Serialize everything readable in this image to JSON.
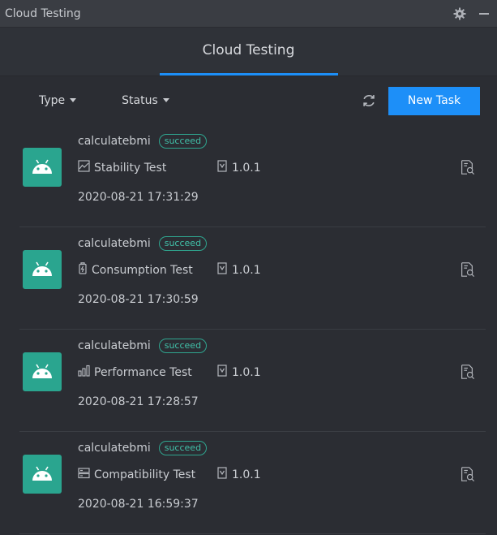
{
  "window": {
    "title": "Cloud Testing"
  },
  "header": {
    "settings_icon": "gear-icon",
    "minimize_icon": "minimize-icon"
  },
  "tabs": [
    {
      "label": "Cloud Testing",
      "active": true
    }
  ],
  "toolbar": {
    "type_label": "Type",
    "status_label": "Status",
    "refresh_icon": "refresh-icon",
    "new_task_label": "New Task"
  },
  "colors": {
    "accent": "#1d8ff8",
    "avatar": "#2aa58f",
    "badge": "#41c1a9",
    "background": "#2b2d33"
  },
  "tasks": [
    {
      "app": "calculatebmi",
      "status": "succeed",
      "type": "Stability Test",
      "type_icon": "stability-chart-icon",
      "version": "1.0.1",
      "timestamp": "2020-08-21 17:31:29"
    },
    {
      "app": "calculatebmi",
      "status": "succeed",
      "type": "Consumption Test",
      "type_icon": "battery-icon",
      "version": "1.0.1",
      "timestamp": "2020-08-21 17:30:59"
    },
    {
      "app": "calculatebmi",
      "status": "succeed",
      "type": "Performance Test",
      "type_icon": "bar-chart-icon",
      "version": "1.0.1",
      "timestamp": "2020-08-21 17:28:57"
    },
    {
      "app": "calculatebmi",
      "status": "succeed",
      "type": "Compatibility Test",
      "type_icon": "server-icon",
      "version": "1.0.1",
      "timestamp": "2020-08-21 16:59:37"
    }
  ]
}
